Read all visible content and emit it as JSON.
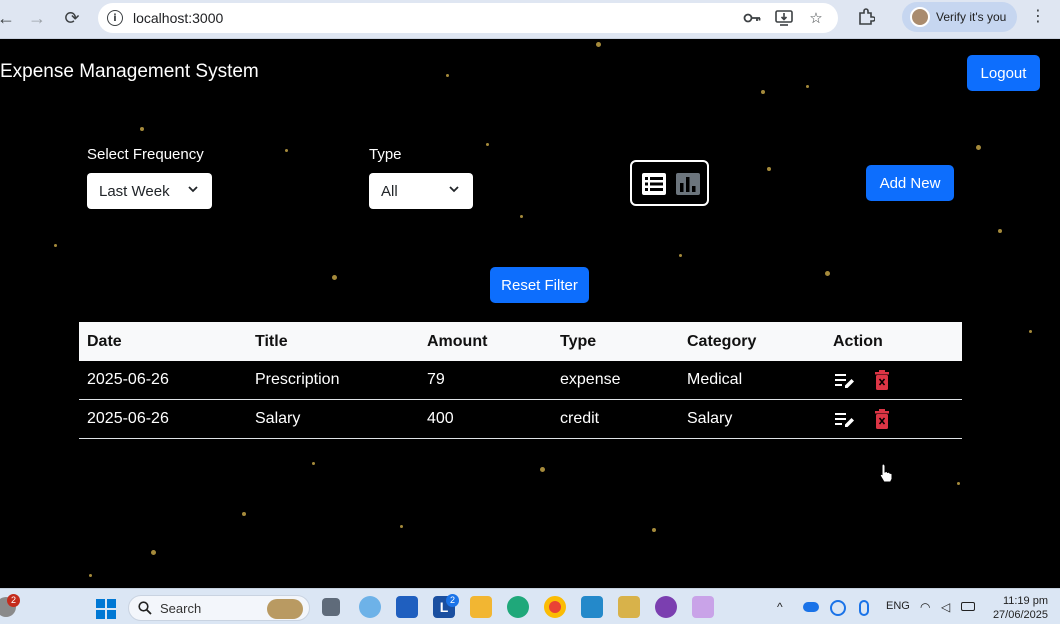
{
  "browser": {
    "url": "localhost:3000",
    "profile_label": "Verify it's you"
  },
  "app": {
    "title": "Expense Management System",
    "logout_label": "Logout",
    "filters": {
      "frequency_label": "Select Frequency",
      "frequency_value": "Last Week",
      "type_label": "Type",
      "type_value": "All"
    },
    "add_new_label": "Add New",
    "reset_filter_label": "Reset Filter",
    "view_modes": [
      "list-icon",
      "chart-icon"
    ]
  },
  "table": {
    "headers": [
      "Date",
      "Title",
      "Amount",
      "Type",
      "Category",
      "Action"
    ],
    "rows": [
      {
        "date": "2025-06-26",
        "title": "Prescription",
        "amount": "79",
        "type": "expense",
        "category": "Medical"
      },
      {
        "date": "2025-06-26",
        "title": "Salary",
        "amount": "400",
        "type": "credit",
        "category": "Salary"
      }
    ]
  },
  "taskbar": {
    "search_placeholder": "Search",
    "notification_count": "2",
    "app_badge": "2",
    "language": "ENG",
    "time": "11:19 pm",
    "date": "27/06/2025"
  },
  "colors": {
    "primary": "#0d6efd",
    "delete": "#dc3545",
    "star": "#a58a3b"
  }
}
